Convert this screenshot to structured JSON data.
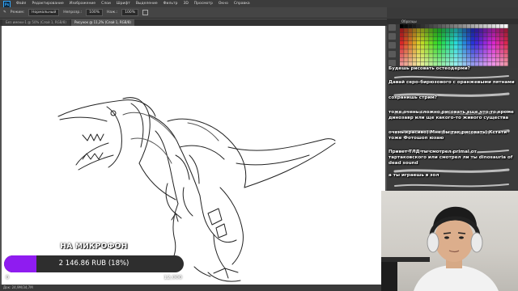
{
  "menu": {
    "logo": "Ps",
    "items": [
      "Файл",
      "Редактирование",
      "Изображение",
      "Слои",
      "Шрифт",
      "Выделение",
      "Фильтр",
      "3D",
      "Просмотр",
      "Окно",
      "Справка"
    ]
  },
  "options": {
    "mode_label": "Режим:",
    "mode_value": "Нормальный",
    "opacity_label": "Непрозр.:",
    "opacity_value": "100%",
    "flow_label": "Наж.:",
    "flow_value": "100%",
    "workspace": "Рисование"
  },
  "tabs": [
    {
      "label": "Без имени-1 @ 50% (Слой 1, RGB/8)"
    },
    {
      "label": "Рисунок @ 11,2% (Слой 1, RGB/8)"
    }
  ],
  "status": "Док: 24,9М/34,7М",
  "panels": {
    "swatches_title": "Образцы"
  },
  "chat": [
    "Будешь рисовать остеодерми?",
    "Давай серо-бирюзового с оранжевыми пятнами",
    "сохранишь стрим?",
    "тоже очень сложно рисовать еще что-то кроме динозавр или ще какого-то живого существа",
    "очень красиво) Мне бы так рисовать) Кстати тоже Фотошоп юзаю",
    "Привет ТЛД ты смотрел primal от тартаковского или смотрел ли ты dinosauria of dead sound",
    "а ты играешь в зол"
  ],
  "donation": {
    "title": "НА МИКРОФОН",
    "amount_text": "2 146.86 RUB (18%)",
    "progress": 0.18,
    "min_label": "0",
    "max_label": "12,000",
    "bar_color": "#8f1cf0"
  },
  "colors": {
    "ui_dark": "#3a3a3a",
    "canvas": "#ffffff",
    "accent": "#31a8ff"
  }
}
